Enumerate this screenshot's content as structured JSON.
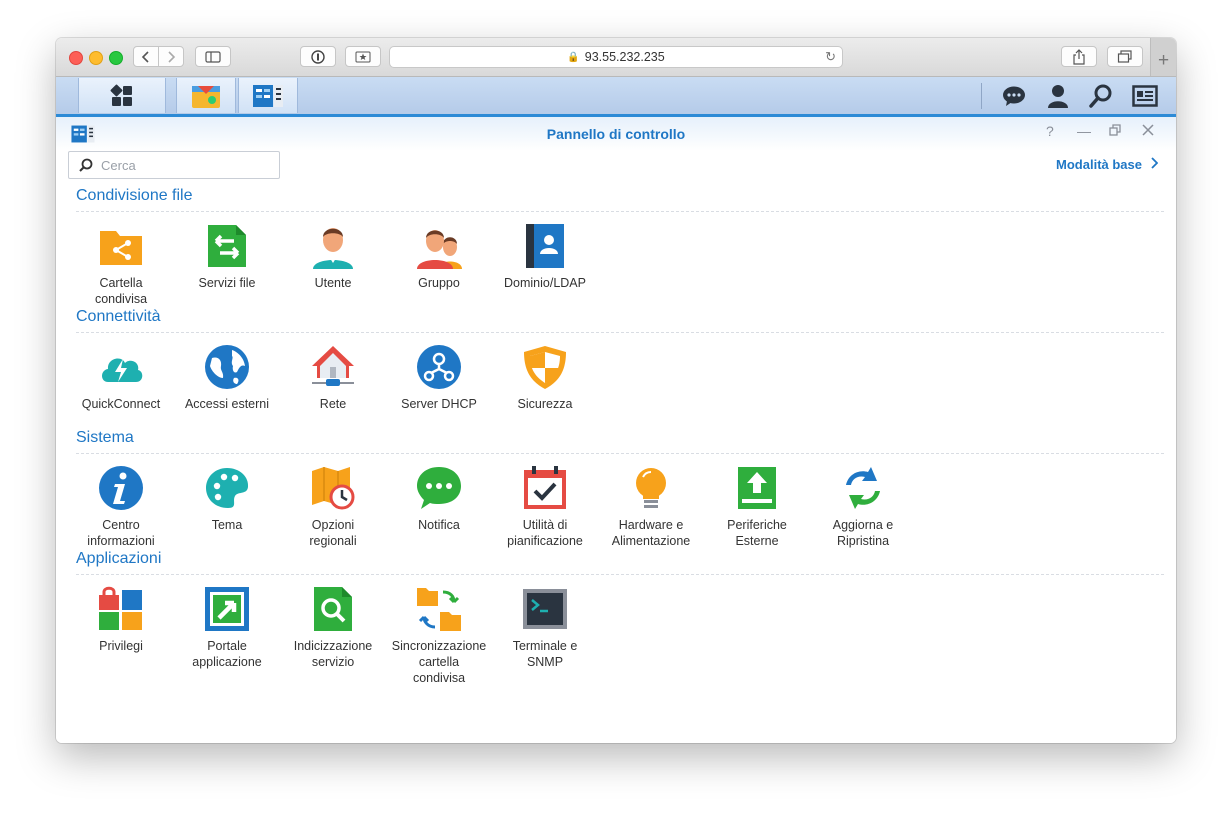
{
  "browser": {
    "address": "93.55.232.235"
  },
  "control_panel": {
    "title": "Pannello di controllo",
    "search_placeholder": "Cerca",
    "basic_mode_label": "Modalità base",
    "sections": [
      {
        "title": "Condivisione file",
        "items": [
          {
            "label": "Cartella\ncondivisa",
            "icon": "shared-folder-icon"
          },
          {
            "label": "Servizi file",
            "icon": "file-services-icon"
          },
          {
            "label": "Utente",
            "icon": "user-icon"
          },
          {
            "label": "Gruppo",
            "icon": "group-icon"
          },
          {
            "label": "Dominio/LDAP",
            "icon": "domain-ldap-icon"
          }
        ]
      },
      {
        "title": "Connettività",
        "items": [
          {
            "label": "QuickConnect",
            "icon": "quickconnect-icon"
          },
          {
            "label": "Accessi esterni",
            "icon": "external-access-icon"
          },
          {
            "label": "Rete",
            "icon": "network-icon"
          },
          {
            "label": "Server DHCP",
            "icon": "dhcp-server-icon"
          },
          {
            "label": "Sicurezza",
            "icon": "security-icon"
          }
        ]
      },
      {
        "title": "Sistema",
        "items": [
          {
            "label": "Centro\ninformazioni",
            "icon": "info-center-icon"
          },
          {
            "label": "Tema",
            "icon": "theme-icon"
          },
          {
            "label": "Opzioni\nregionali",
            "icon": "regional-options-icon"
          },
          {
            "label": "Notifica",
            "icon": "notification-icon"
          },
          {
            "label": "Utilità di\npianificazione",
            "icon": "task-scheduler-icon"
          },
          {
            "label": "Hardware e\nAlimentazione",
            "icon": "hardware-power-icon"
          },
          {
            "label": "Periferiche\nEsterne",
            "icon": "external-devices-icon"
          },
          {
            "label": "Aggiorna e\nRipristina",
            "icon": "update-restore-icon"
          }
        ]
      },
      {
        "title": "Applicazioni",
        "items": [
          {
            "label": "Privilegi",
            "icon": "privileges-icon"
          },
          {
            "label": "Portale\napplicazione",
            "icon": "application-portal-icon"
          },
          {
            "label": "Indicizzazione\nservizio",
            "icon": "indexing-service-icon"
          },
          {
            "label": "Sincronizzazione\ncartella\ncondivisa",
            "icon": "shared-folder-sync-icon"
          },
          {
            "label": "Terminale e\nSNMP",
            "icon": "terminal-snmp-icon"
          }
        ]
      }
    ]
  }
}
